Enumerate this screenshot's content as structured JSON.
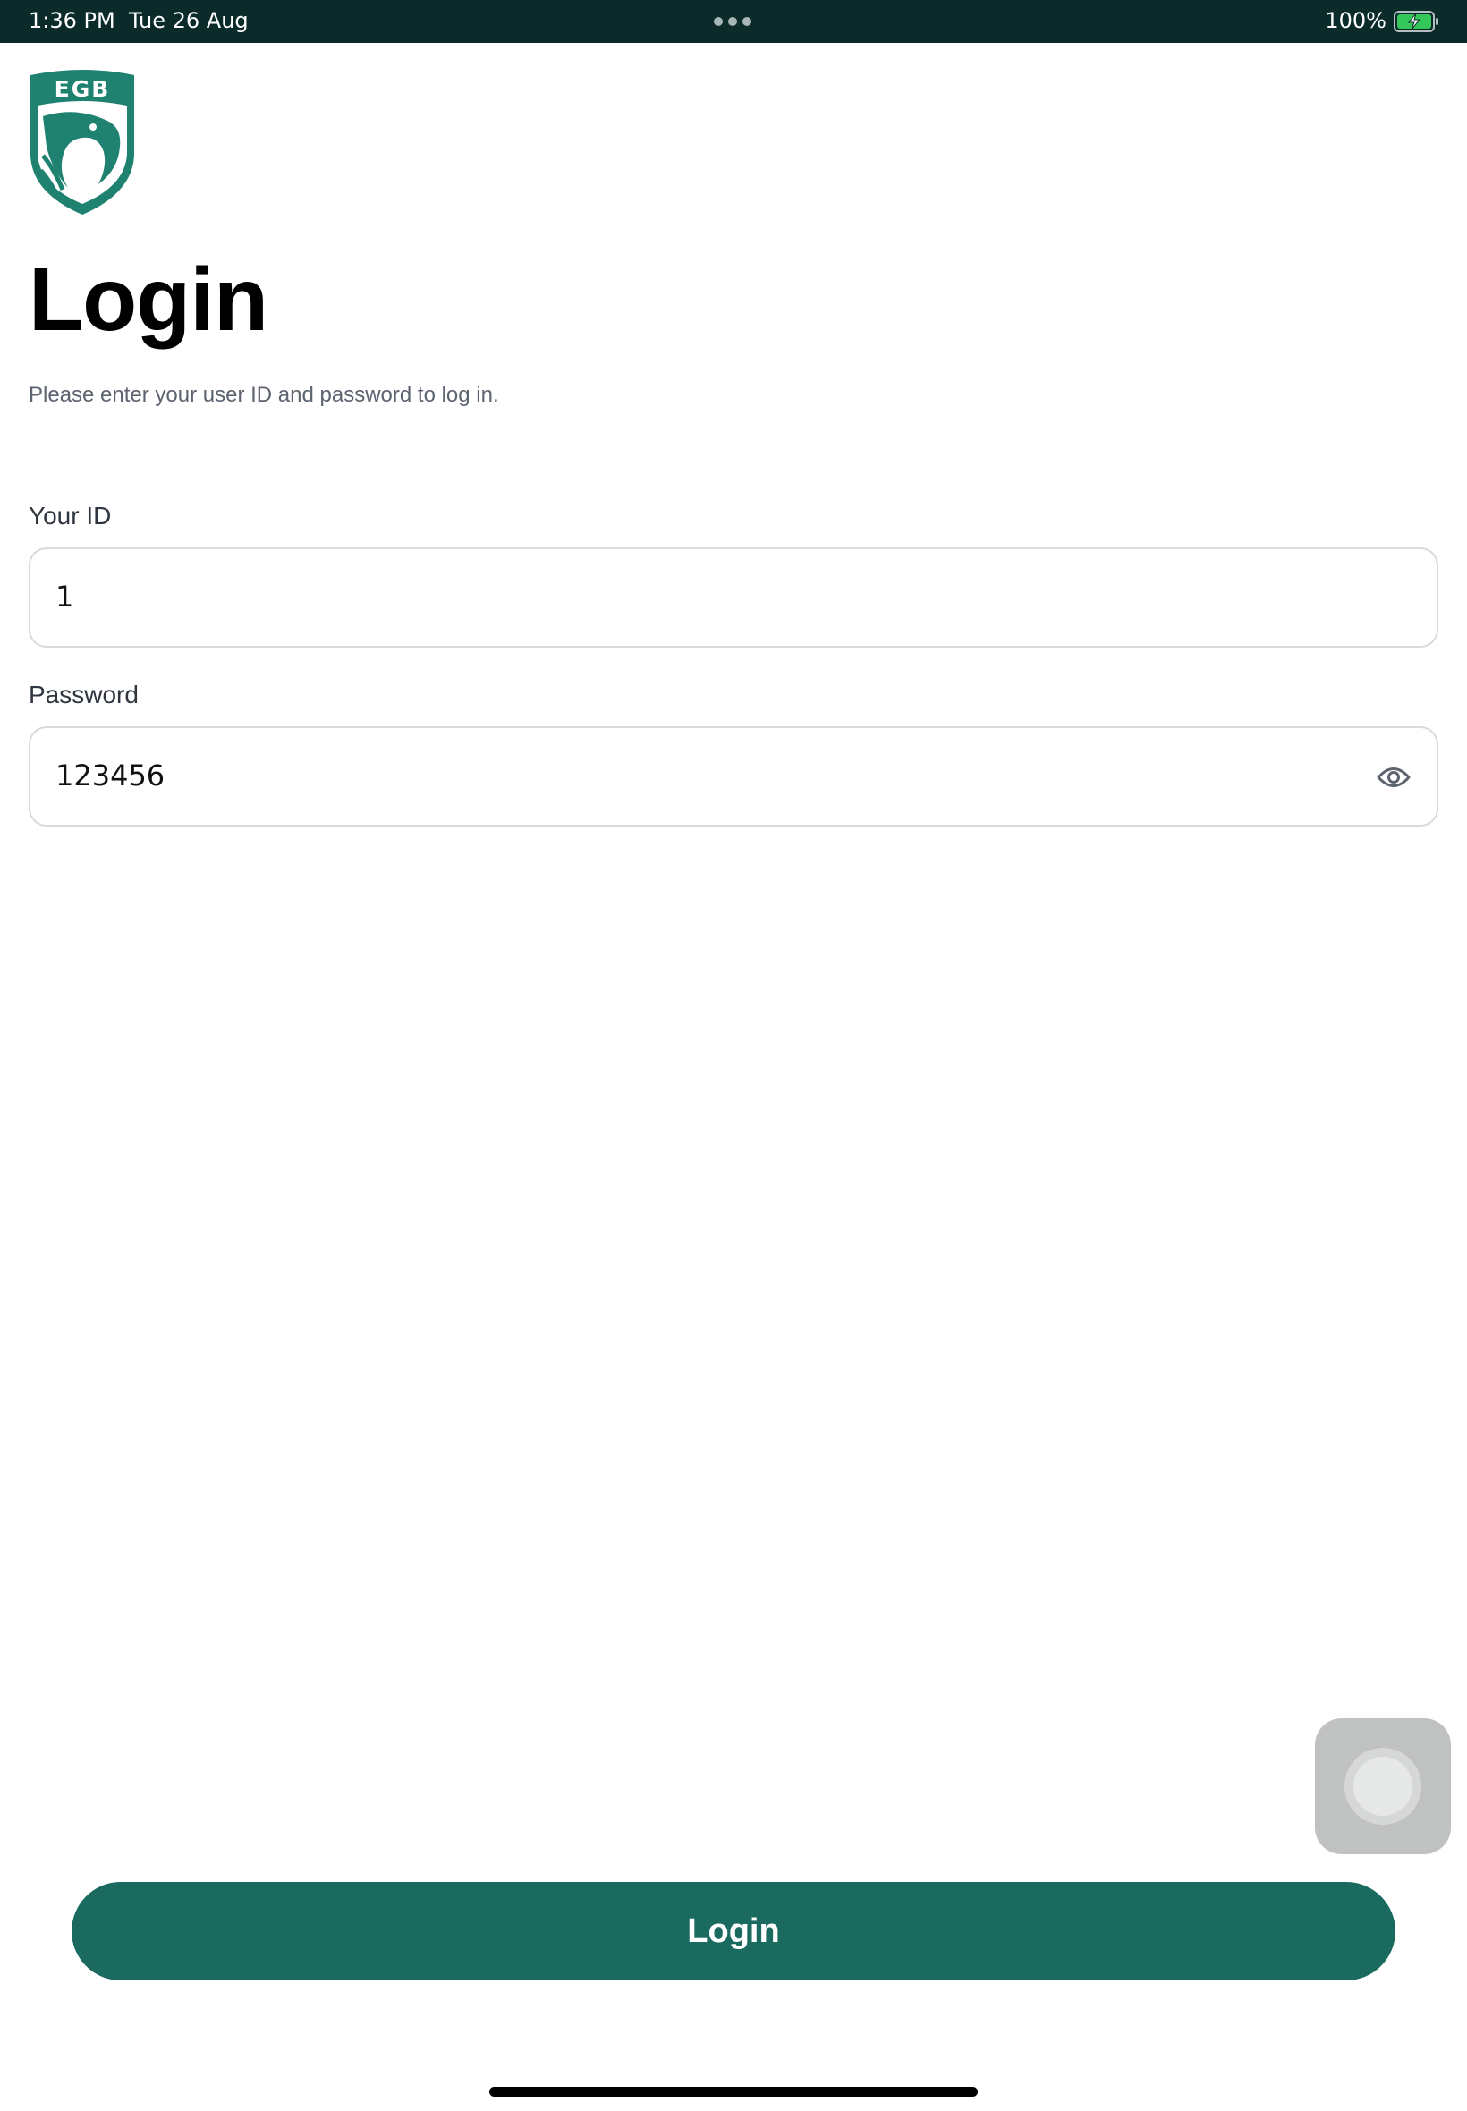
{
  "status_bar": {
    "time": "1:36 PM",
    "date": "Tue 26 Aug",
    "battery_text": "100%",
    "battery_icon": "battery-charging-icon",
    "colors": {
      "background": "#0b2a2a",
      "battery_fill": "#34c759"
    }
  },
  "logo": {
    "text": "EGB",
    "icon": "eagle-shield-logo",
    "color": "#1f8270"
  },
  "page": {
    "title": "Login",
    "subtitle": "Please enter your user ID and password to log in."
  },
  "form": {
    "id_label": "Your ID",
    "id_value": "1",
    "password_label": "Password",
    "password_value": "123456",
    "password_toggle_icon": "eye-icon"
  },
  "login_button": {
    "label": "Login",
    "color": "#1b6a5f"
  },
  "assistive_touch": {
    "icon": "assistive-touch-icon"
  }
}
